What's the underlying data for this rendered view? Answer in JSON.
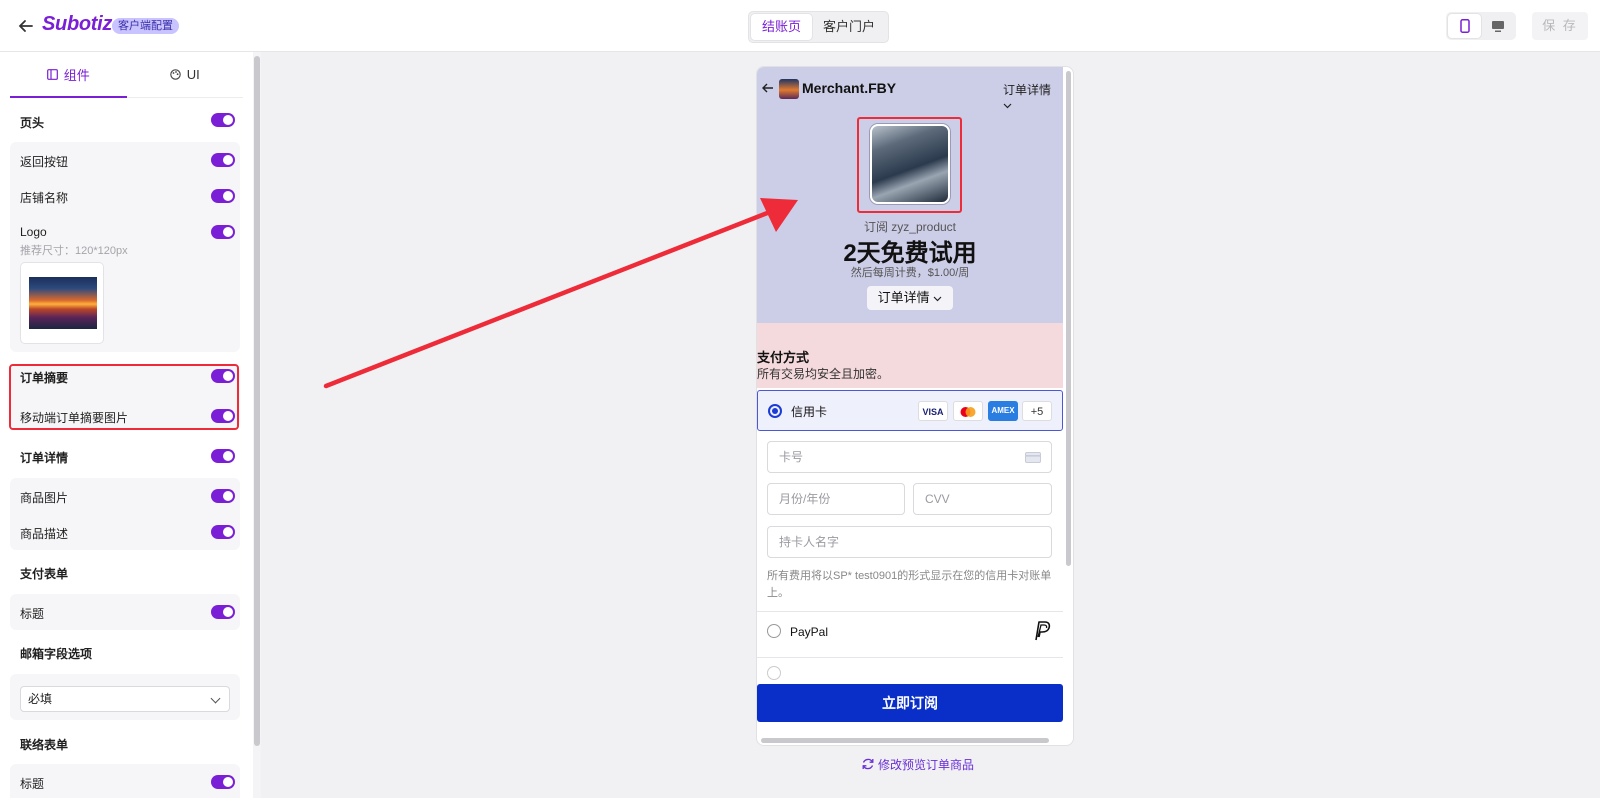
{
  "header": {
    "brand": "Subotiz",
    "brand_tag": "客户端配置",
    "seg_tabs": [
      "结账页",
      "客户门户"
    ],
    "save_label": "保 存",
    "accent_color": "#7a1fd6"
  },
  "left_panel": {
    "tabs": [
      "组件",
      "UI"
    ],
    "sections": {
      "header": "页头",
      "back_button": "返回按钮",
      "store_name": "店铺名称",
      "logo": "Logo",
      "logo_hint": "推荐尺寸：120*120px",
      "order_summary": "订单摘要",
      "mobile_summary_image": "移动端订单摘要图片",
      "order_details": "订单详情",
      "product_image": "商品图片",
      "product_description": "商品描述",
      "payment_form": "支付表单",
      "title": "标题",
      "email_option": "邮箱字段选项",
      "email_select_value": "必填",
      "contact_form": "联络表单",
      "contact_title": "标题"
    },
    "toggles_on": true
  },
  "preview": {
    "merchant": "Merchant.FBY",
    "order_details_top": "订单详情",
    "subscription": "订阅 zyz_product",
    "trial": "2天免费试用",
    "price": "然后每周计费，$1.00/周",
    "order_details_btn": "订单详情",
    "payment_title": "支付方式",
    "payment_sub": "所有交易均安全且加密。",
    "credit_card": "信用卡",
    "card_brands": [
      "VISA",
      "MC",
      "AMEX",
      "+5"
    ],
    "card_number_placeholder": "卡号",
    "expiry_placeholder": "月份/年份",
    "cvv_placeholder": "CVV",
    "holder_placeholder": "持卡人名字",
    "note": "所有费用将以SP* test0901的形式显示在您的信用卡对账单上。",
    "paypal": "PayPal",
    "subscribe_btn": "立即订阅",
    "subscribe_color": "#0a2ec8"
  },
  "modify_link": "修改预览订单商品"
}
